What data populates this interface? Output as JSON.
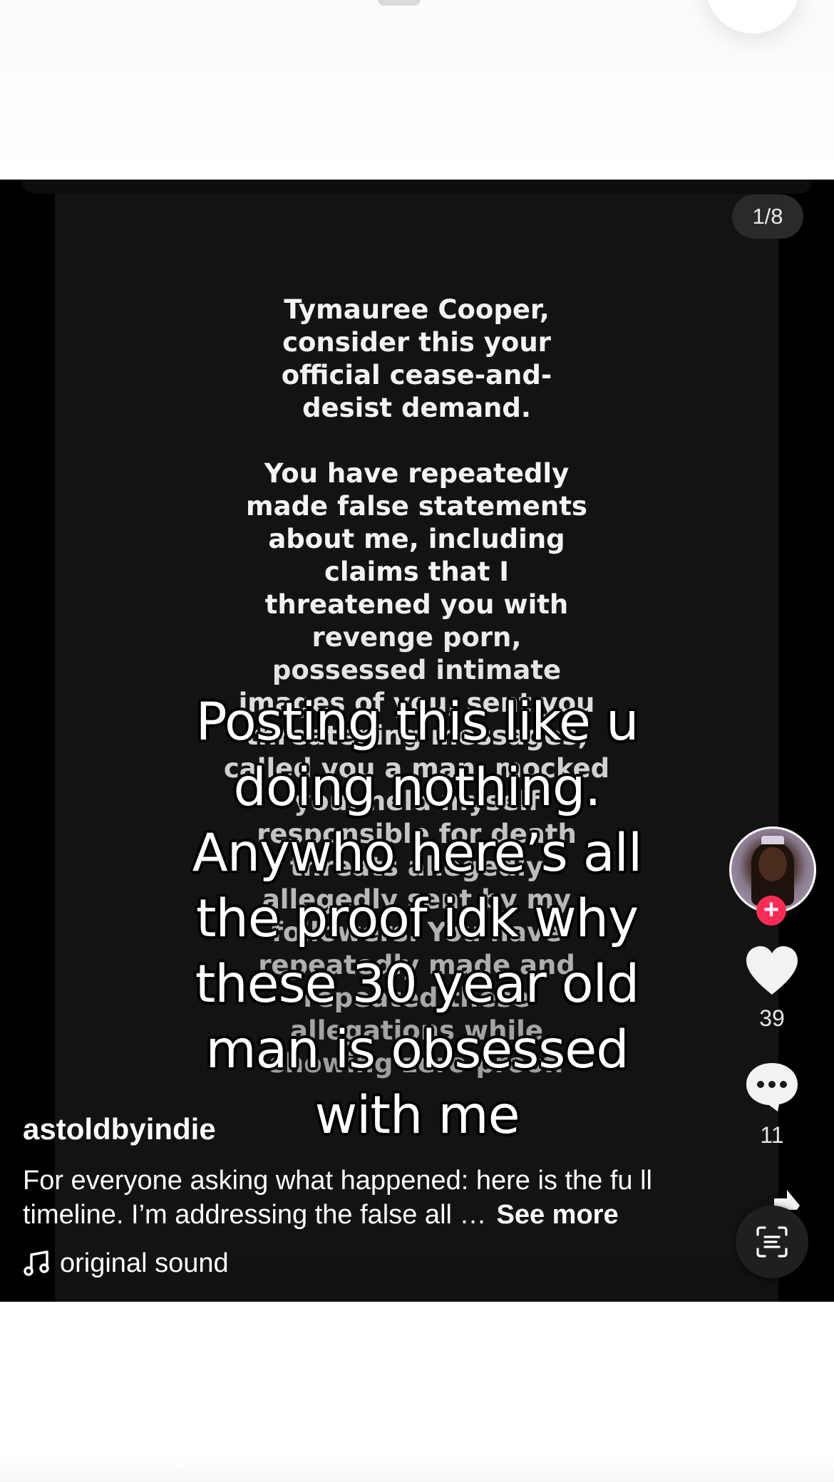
{
  "header": {
    "close_icon": "close-icon"
  },
  "post": {
    "page_counter": "1/8",
    "story_text": "Tymauree Cooper,\nconsider this your\nofficial cease-and-\ndesist demand.\n\nYou have repeatedly\nmade false statements\nabout me, including\nclaims that I\nthreatened you with\nrevenge porn,\npossessed intimate\nimages of you, sent you\nthreatening messages,\ncalled you a man, mocked\nyou, held myself\nresponsible for death\nthreats allegedly\nallegedly sent by my\nfollowers. You have\nrepeatedly made and\nrepeated these\nallegations while\nshowing zero proof.",
    "overlay_caption": "Posting this like u doing nothing. Anywho here’s all the proof idk why these 30 year old man is obsessed with me",
    "username": "astoldbyindie",
    "description": "For everyone asking what happened: here is the fu ll timeline. I’m addressing the false all …",
    "see_more": "See more",
    "sound": "original sound"
  },
  "actions": {
    "likes": "39",
    "comments": "11",
    "follow_symbol": "+"
  },
  "colors": {
    "follow_accent": "#fe2c55",
    "video_background": "#000000",
    "story_background": "#131313"
  }
}
